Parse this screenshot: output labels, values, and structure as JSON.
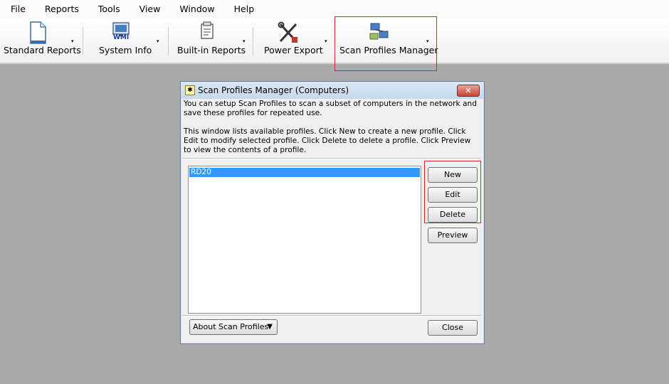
{
  "menu": [
    "File",
    "Reports",
    "Tools",
    "View",
    "Window",
    "Help"
  ],
  "toolbar": {
    "standard_reports": "Standard Reports",
    "system_info": "System Info",
    "wmi_badge": "WMI",
    "builtin_reports": "Built-in Reports",
    "power_export": "Power Export",
    "scan_profiles_manager": "Scan Profiles Manager",
    "dropdown_glyph": "▾"
  },
  "dialog": {
    "title": "Scan Profiles Manager (Computers)",
    "close_glyph": "✕",
    "description_1": "You can setup Scan Profiles to scan a subset of computers in the network and save these profiles for repeated use.",
    "description_2": "This window lists available profiles. Click New to create a new profile. Click Edit to modify selected profile. Click Delete to delete a profile. Click Preview to view the contents of a profile.",
    "profiles": [
      "RD20"
    ],
    "buttons": {
      "new": "New",
      "edit": "Edit",
      "delete": "Delete",
      "preview": "Preview",
      "about": "About Scan Profiles",
      "close": "Close"
    }
  },
  "colors": {
    "highlight": "#d9242a",
    "selection": "#3399ff"
  }
}
